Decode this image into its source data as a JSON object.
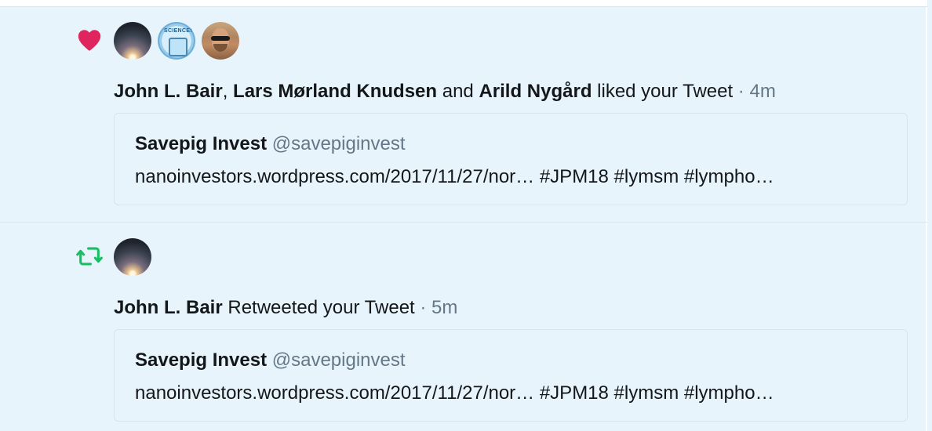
{
  "colors": {
    "like": "#e0245e",
    "retweet": "#17bf63",
    "muted": "#657786",
    "background": "#e8f4fc"
  },
  "notifications": [
    {
      "type_icon": "heart-icon",
      "avatars": [
        "avatar-night-sky",
        "avatar-science",
        "avatar-sunglasses"
      ],
      "actor1": "John L. Bair",
      "sep1": ", ",
      "actor2": "Lars Mørland Knudsen",
      "sep2": " and ",
      "actor3": "Arild Nygård",
      "action": " liked your Tweet",
      "time": " · 4m",
      "tweet": {
        "author_name": "Savepig Invest",
        "author_handle": "@savepiginvest",
        "text": "nanoinvestors.wordpress.com/2017/11/27/nor… #JPM18 #lymsm #lympho…"
      }
    },
    {
      "type_icon": "retweet-icon",
      "avatars": [
        "avatar-night-sky"
      ],
      "actor1": "John L. Bair",
      "action": " Retweeted your Tweet",
      "time": " · 5m",
      "tweet": {
        "author_name": "Savepig Invest",
        "author_handle": "@savepiginvest",
        "text": "nanoinvestors.wordpress.com/2017/11/27/nor… #JPM18 #lymsm #lympho…"
      }
    }
  ]
}
